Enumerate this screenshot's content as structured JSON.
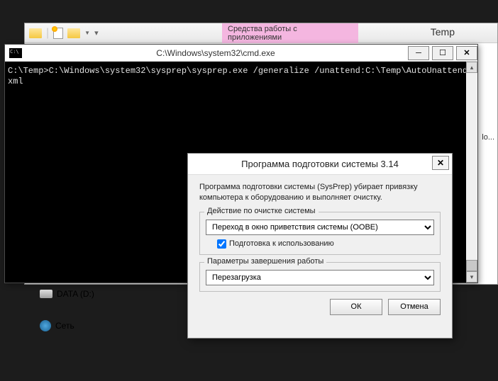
{
  "explorer": {
    "ribbon_tab": "Средства работы с приложениями",
    "title": "Temp",
    "tree": {
      "data_drive": "DATA (D:)",
      "network": "Сеть"
    },
    "truncated_text": "lo..."
  },
  "cmd": {
    "title": "C:\\Windows\\system32\\cmd.exe",
    "prompt_line": "C:\\Temp>C:\\Windows\\system32\\sysprep\\sysprep.exe /generalize /unattend:C:\\Temp\\AutoUnattend.xml"
  },
  "sysprep": {
    "title": "Программа подготовки системы 3.14",
    "description": "Программа подготовки системы (SysPrep) убирает привязку компьютера к оборудованию и выполняет очистку.",
    "cleanup_label": "Действие по очистке системы",
    "cleanup_value": "Переход в окно приветствия системы (OOBE)",
    "generalize_label": "Подготовка к использованию",
    "shutdown_label": "Параметры завершения работы",
    "shutdown_value": "Перезагрузка",
    "ok": "ОК",
    "cancel": "Отмена"
  }
}
